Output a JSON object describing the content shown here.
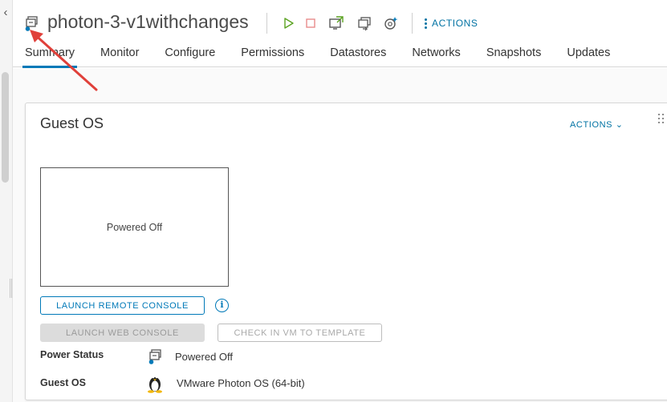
{
  "vm": {
    "name": "photon-3-v1withchanges",
    "icon": "vm-powered-off-icon"
  },
  "toolbar": {
    "icons": [
      "power-on-icon",
      "power-off-icon",
      "launch-console-icon",
      "migrate-icon",
      "snapshot-icon"
    ],
    "actions_label": "ACTIONS"
  },
  "tabs": [
    "Summary",
    "Monitor",
    "Configure",
    "Permissions",
    "Datastores",
    "Networks",
    "Snapshots",
    "Updates"
  ],
  "active_tab": "Summary",
  "guest_os_card": {
    "title": "Guest OS",
    "actions_label": "ACTIONS",
    "console_state": "Powered Off",
    "launch_remote_console": "LAUNCH REMOTE CONSOLE",
    "launch_web_console": "LAUNCH WEB CONSOLE",
    "check_in_template": "CHECK IN VM TO TEMPLATE",
    "power_status_label": "Power Status",
    "power_status_value": "Powered Off",
    "guest_os_label": "Guest OS",
    "guest_os_value": "VMware Photon OS (64-bit)"
  },
  "colors": {
    "accent": "#0079b8",
    "power_on_green": "#5aa220",
    "power_off_red": "#e88c8c",
    "annotation_arrow": "#e0403a"
  }
}
